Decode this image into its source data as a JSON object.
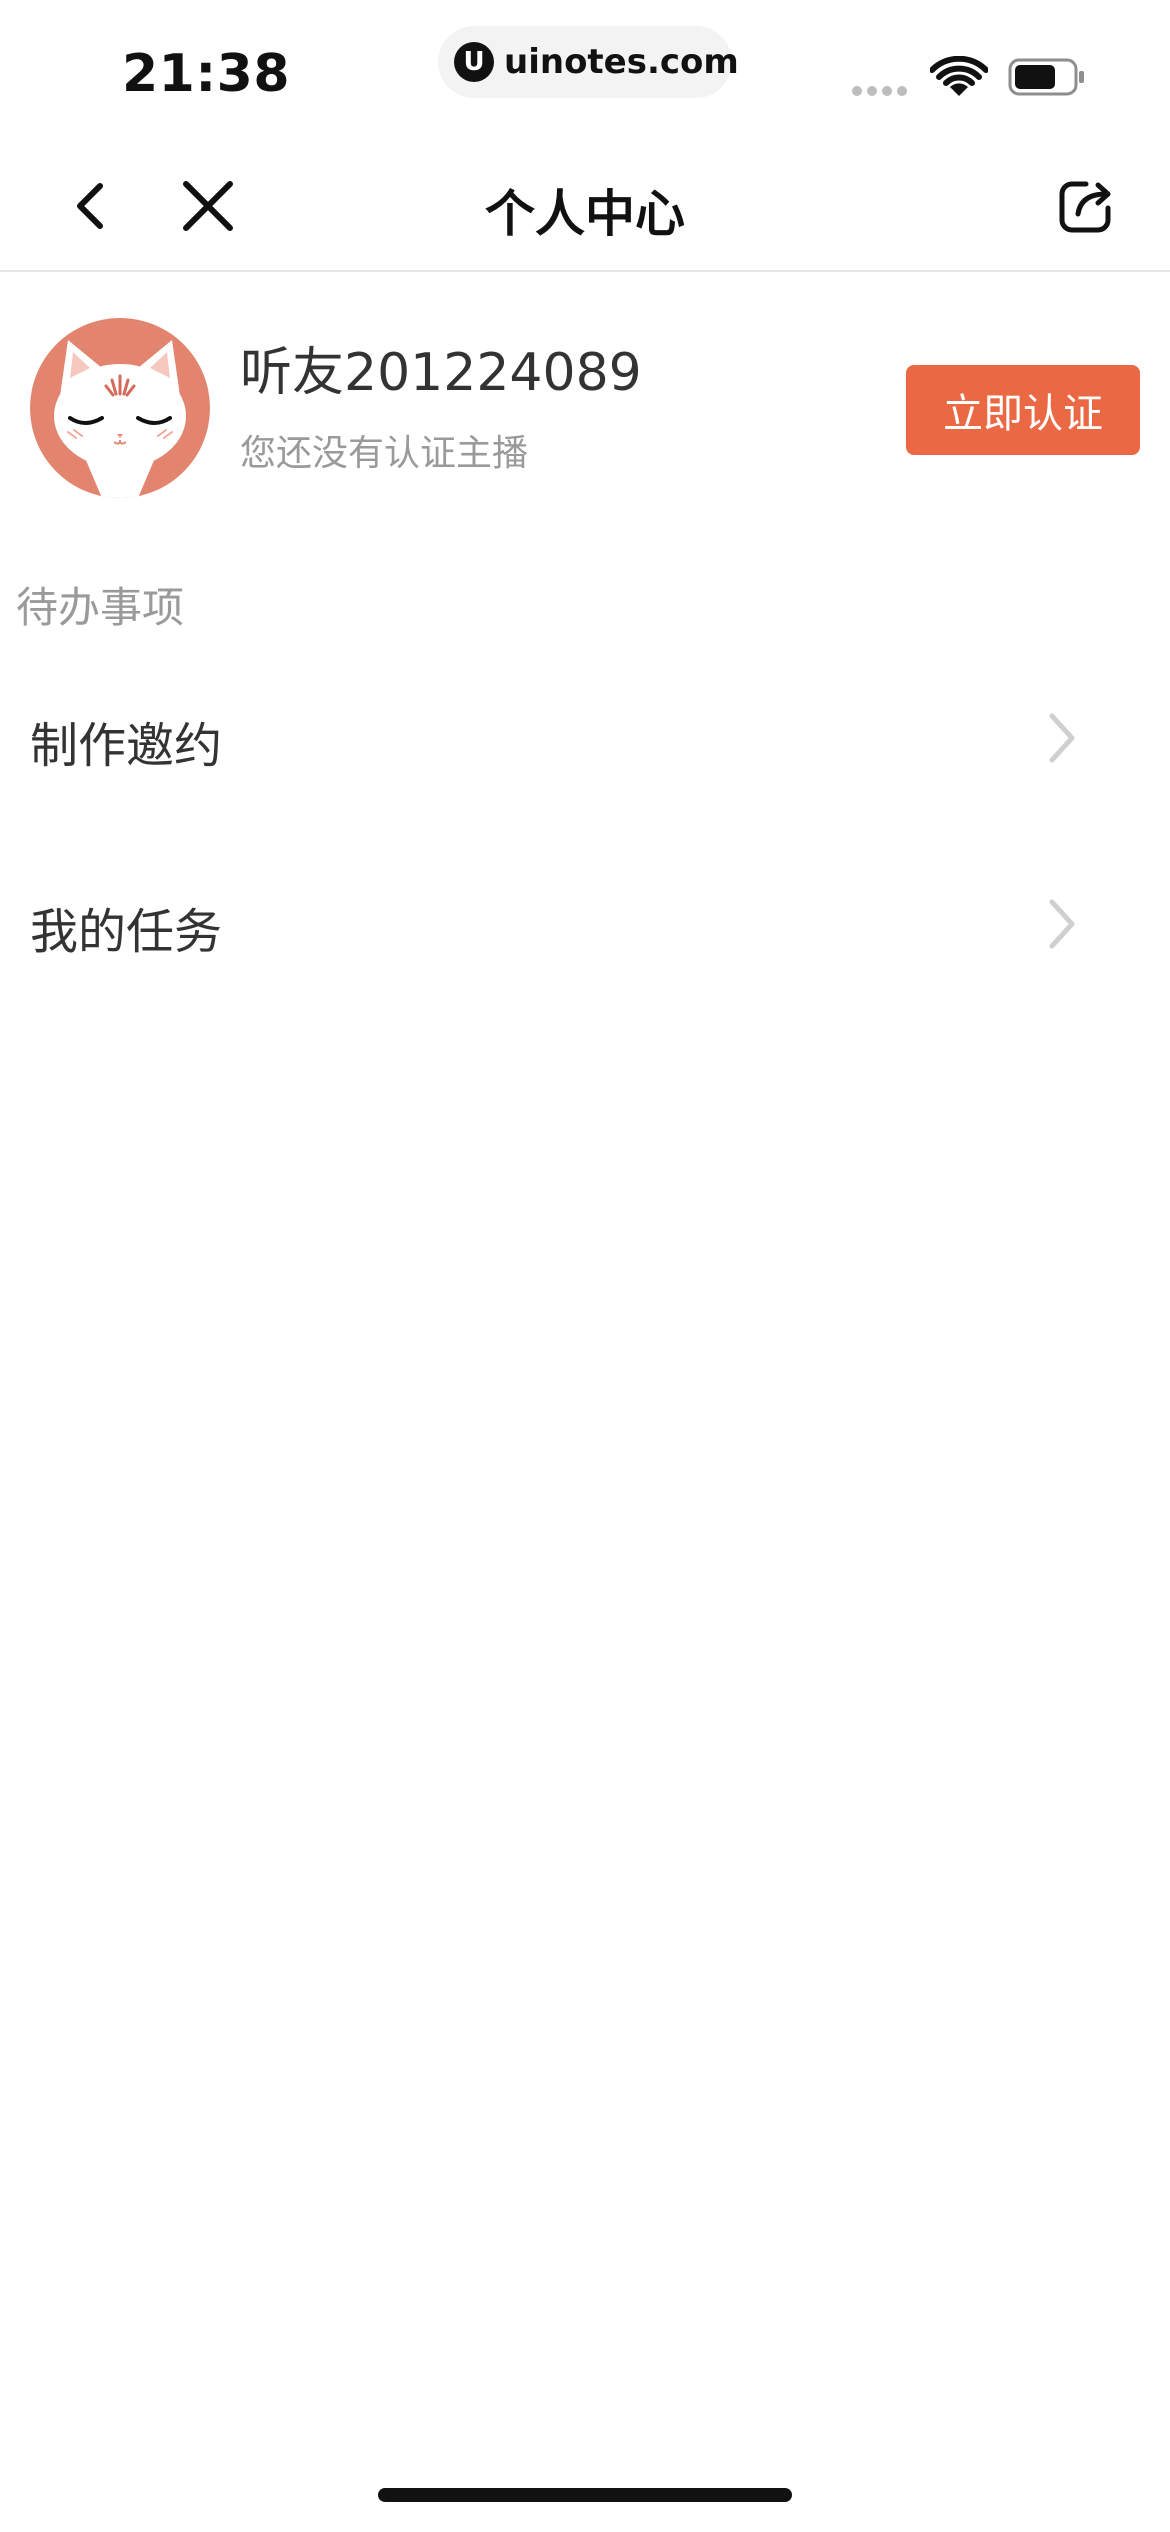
{
  "status_bar": {
    "time": "21:38",
    "url": "uinotes.com",
    "url_logo_letter": "U",
    "icons": [
      "signal-icon",
      "wifi-icon",
      "battery-icon"
    ]
  },
  "nav": {
    "title": "个人中心",
    "icons": [
      "back-icon",
      "close-icon",
      "share-icon"
    ]
  },
  "profile": {
    "username": "听友201224089",
    "cert_status": "您还没有认证主播",
    "verify_button_label": "立即认证",
    "avatar": "cat-avatar-icon"
  },
  "todo": {
    "section_title": "待办事项",
    "items": [
      {
        "label": "制作邀约"
      },
      {
        "label": "我的任务"
      }
    ]
  },
  "colors": {
    "accent": "#ea6844",
    "avatar_bg": "#e3846f",
    "secondary_text": "#9a9a9a",
    "chevron": "#cfcfcf"
  }
}
